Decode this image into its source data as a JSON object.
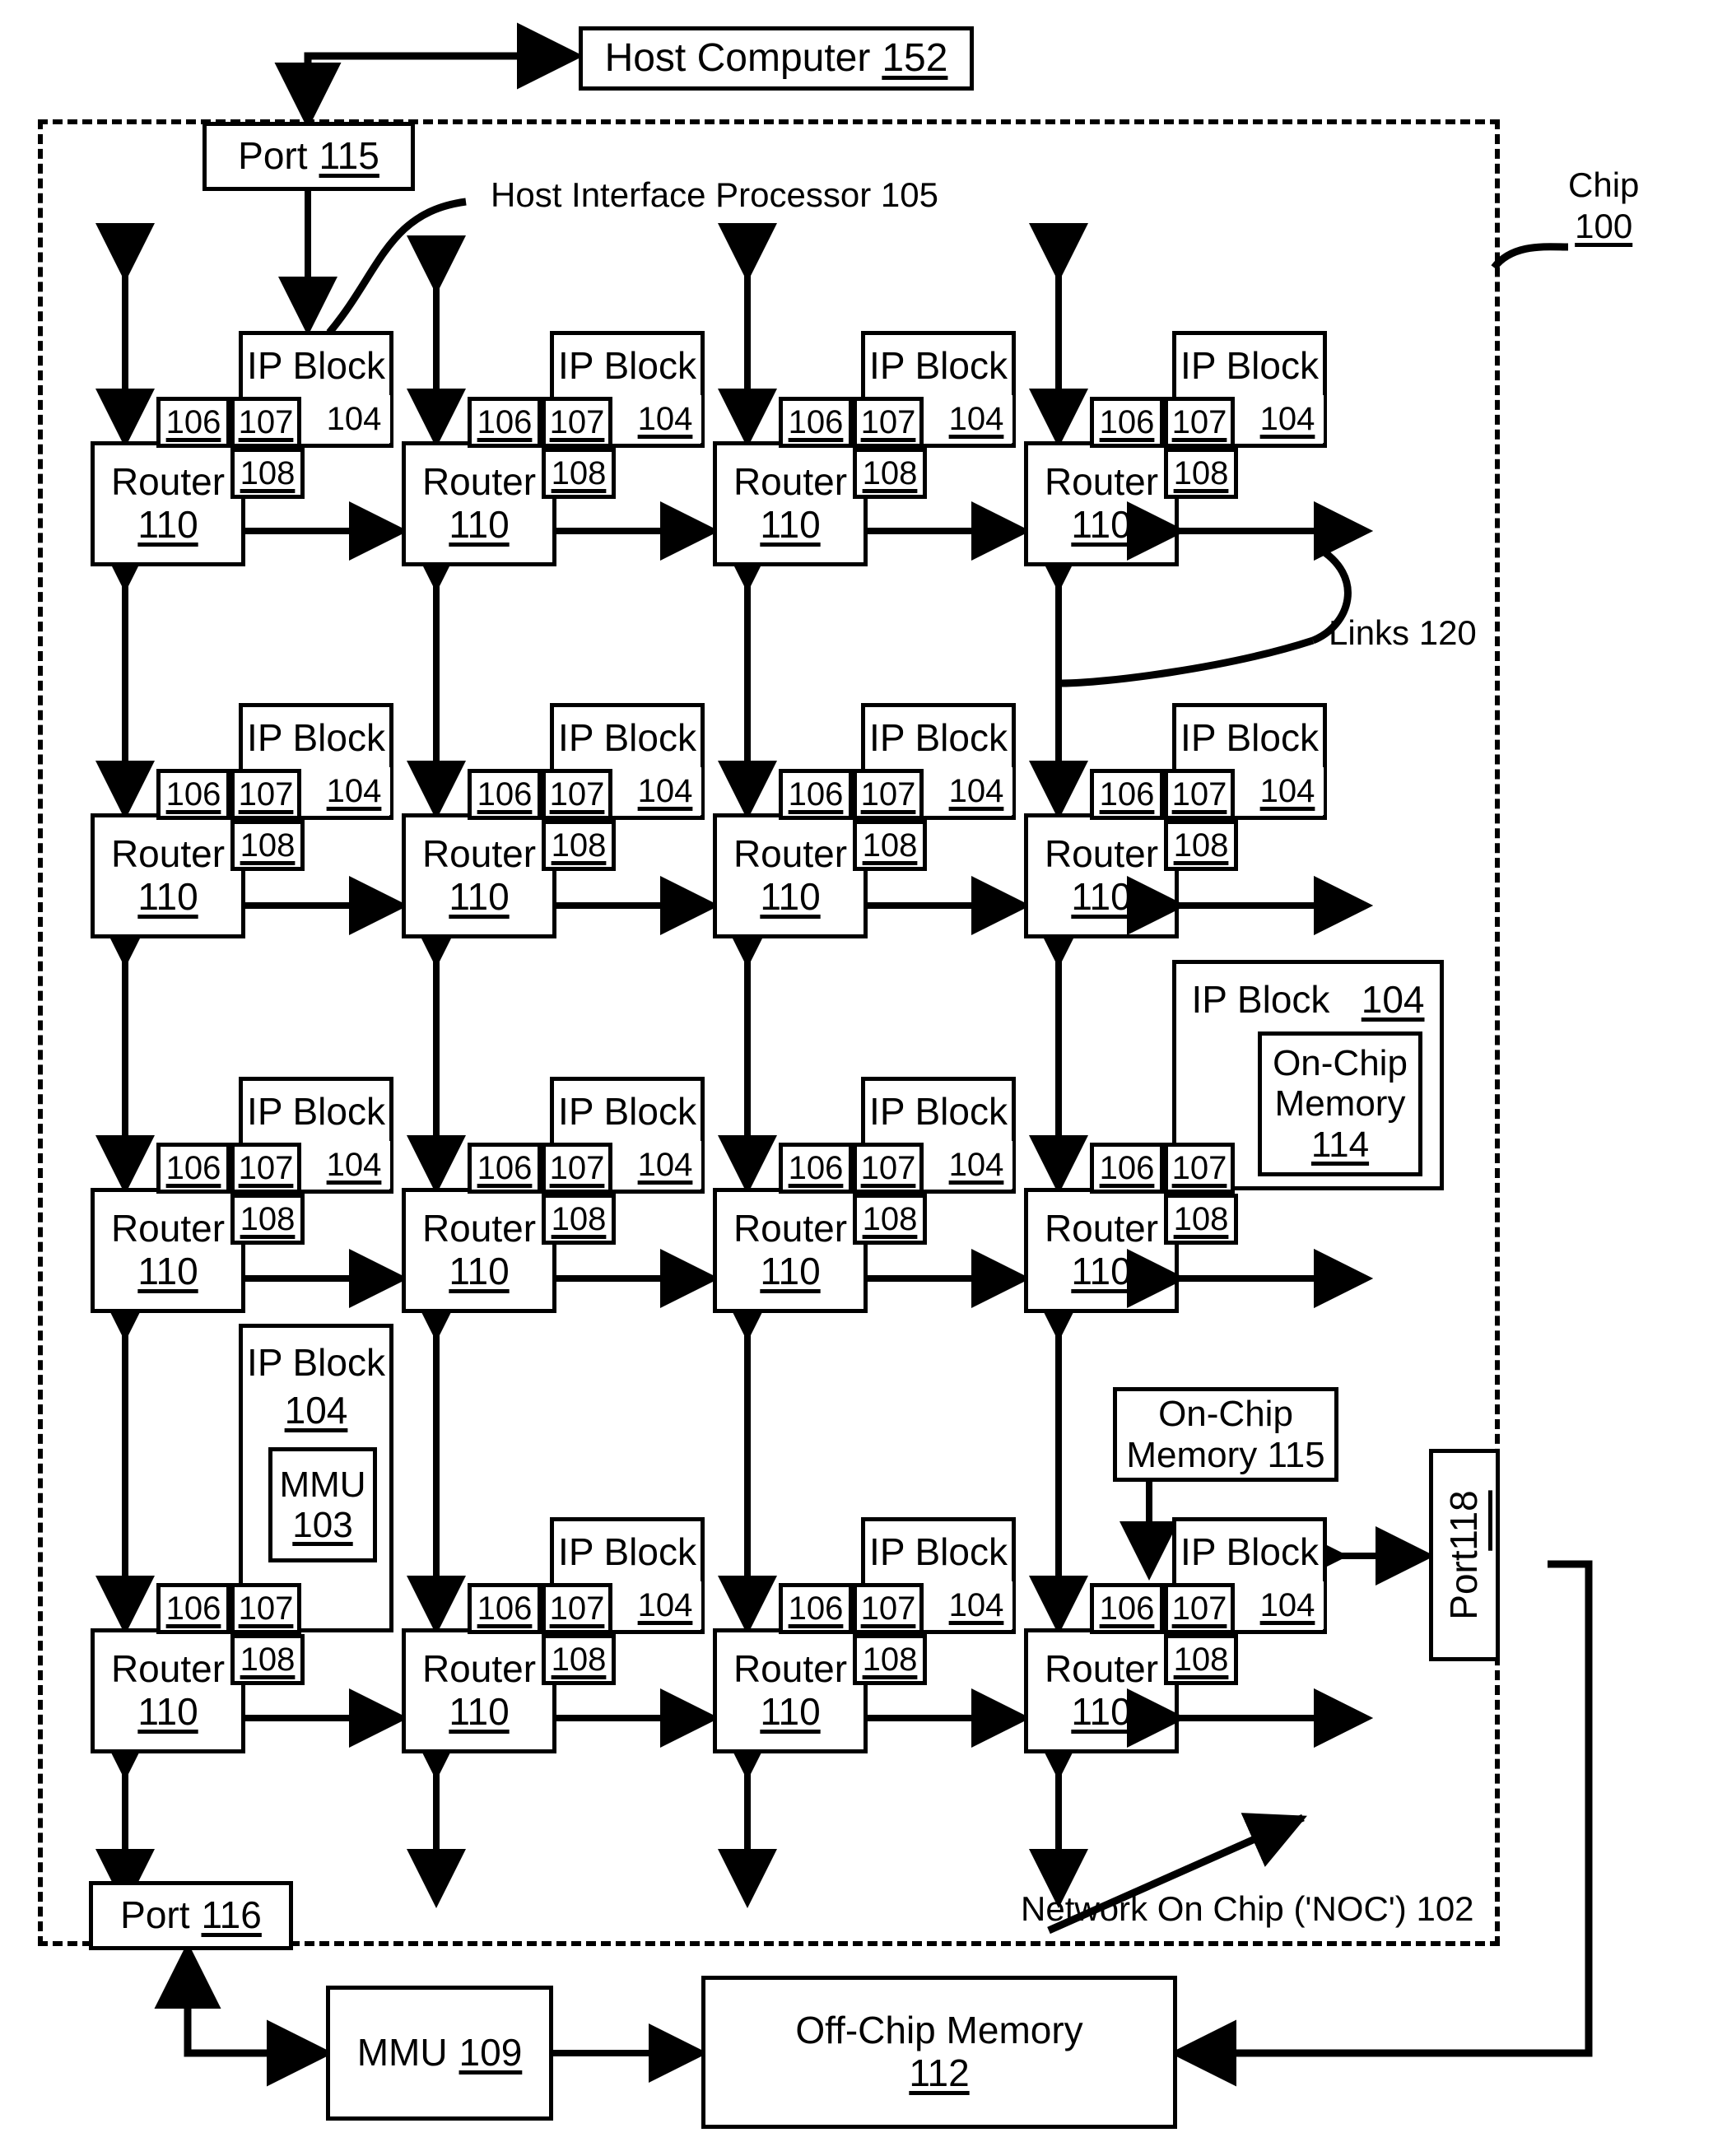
{
  "diagram": {
    "title_labels": {
      "chip": {
        "line1": "Chip",
        "line2": "100"
      },
      "links": "Links 120",
      "host_interface_processor": "Host Interface Processor 105",
      "noc": "Network On Chip ('NOC') 102"
    },
    "host_computer": {
      "label": "Host Computer",
      "ref": "152"
    },
    "port_115": {
      "label": "Port",
      "ref": "115"
    },
    "port_116": {
      "label": "Port",
      "ref": "116"
    },
    "port_118": {
      "label": "Port",
      "ref": "118"
    },
    "mmu_109": {
      "label": "MMU",
      "ref": "109"
    },
    "off_chip_memory": {
      "label": "Off-Chip Memory",
      "ref": "112"
    },
    "on_chip_memory_114": {
      "line1": "On-Chip",
      "line2": "Memory",
      "ref": "114"
    },
    "on_chip_memory_115": {
      "line1": "On-Chip",
      "line2": "Memory 115"
    },
    "mmu_103": {
      "label": "MMU",
      "ref": "103"
    },
    "cell": {
      "router_label": "Router",
      "router_ref": "110",
      "ip_block_label": "IP Block",
      "ip_block_ref": "104",
      "n106": "106",
      "n107": "107",
      "n108": "108"
    },
    "grid": {
      "rows": 4,
      "cols": 4
    },
    "colors": {
      "stroke": "#000000",
      "fill": "#ffffff"
    }
  }
}
